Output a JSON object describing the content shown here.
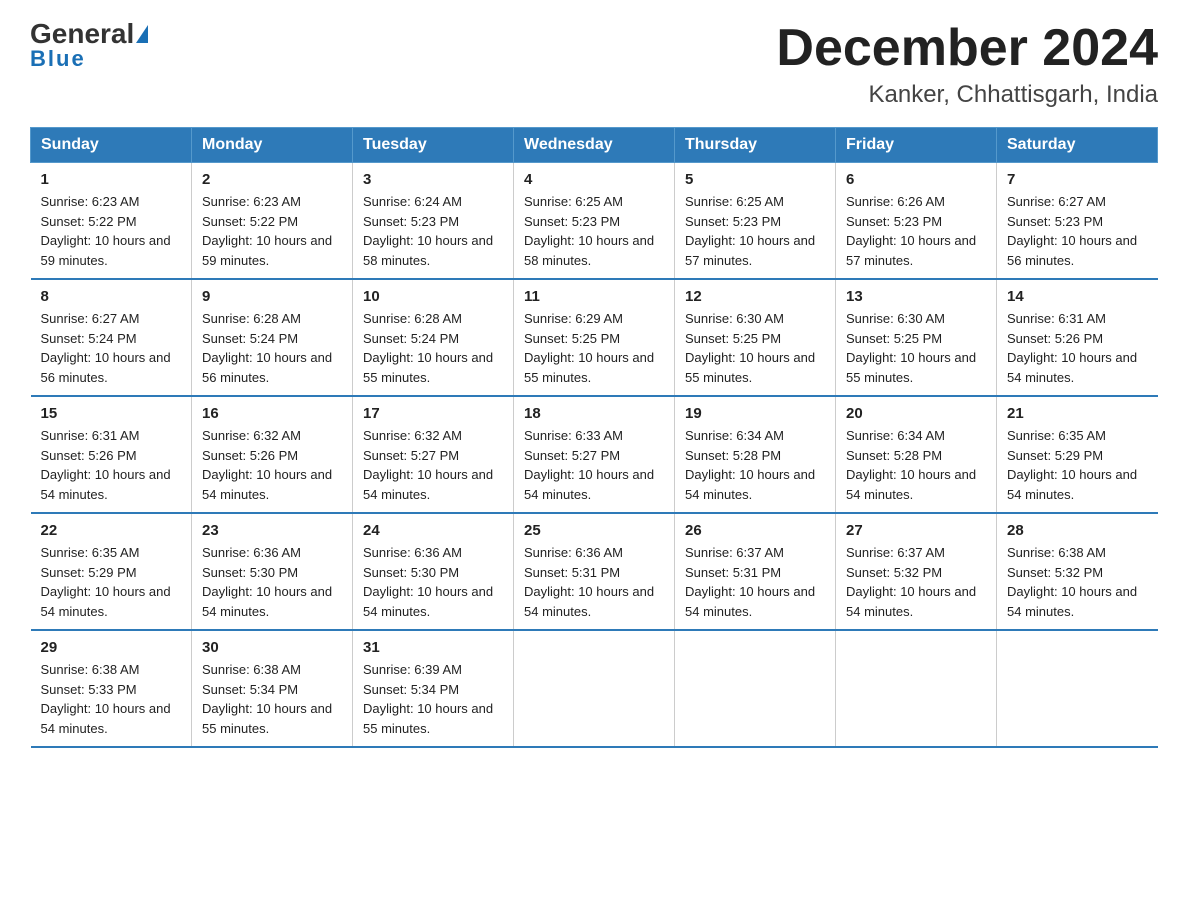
{
  "logo": {
    "text_general": "General",
    "text_blue": "Blue"
  },
  "title": "December 2024",
  "subtitle": "Kanker, Chhattisgarh, India",
  "weekdays": [
    "Sunday",
    "Monday",
    "Tuesday",
    "Wednesday",
    "Thursday",
    "Friday",
    "Saturday"
  ],
  "weeks": [
    [
      {
        "day": "1",
        "sunrise": "6:23 AM",
        "sunset": "5:22 PM",
        "daylight": "10 hours and 59 minutes."
      },
      {
        "day": "2",
        "sunrise": "6:23 AM",
        "sunset": "5:22 PM",
        "daylight": "10 hours and 59 minutes."
      },
      {
        "day": "3",
        "sunrise": "6:24 AM",
        "sunset": "5:23 PM",
        "daylight": "10 hours and 58 minutes."
      },
      {
        "day": "4",
        "sunrise": "6:25 AM",
        "sunset": "5:23 PM",
        "daylight": "10 hours and 58 minutes."
      },
      {
        "day": "5",
        "sunrise": "6:25 AM",
        "sunset": "5:23 PM",
        "daylight": "10 hours and 57 minutes."
      },
      {
        "day": "6",
        "sunrise": "6:26 AM",
        "sunset": "5:23 PM",
        "daylight": "10 hours and 57 minutes."
      },
      {
        "day": "7",
        "sunrise": "6:27 AM",
        "sunset": "5:23 PM",
        "daylight": "10 hours and 56 minutes."
      }
    ],
    [
      {
        "day": "8",
        "sunrise": "6:27 AM",
        "sunset": "5:24 PM",
        "daylight": "10 hours and 56 minutes."
      },
      {
        "day": "9",
        "sunrise": "6:28 AM",
        "sunset": "5:24 PM",
        "daylight": "10 hours and 56 minutes."
      },
      {
        "day": "10",
        "sunrise": "6:28 AM",
        "sunset": "5:24 PM",
        "daylight": "10 hours and 55 minutes."
      },
      {
        "day": "11",
        "sunrise": "6:29 AM",
        "sunset": "5:25 PM",
        "daylight": "10 hours and 55 minutes."
      },
      {
        "day": "12",
        "sunrise": "6:30 AM",
        "sunset": "5:25 PM",
        "daylight": "10 hours and 55 minutes."
      },
      {
        "day": "13",
        "sunrise": "6:30 AM",
        "sunset": "5:25 PM",
        "daylight": "10 hours and 55 minutes."
      },
      {
        "day": "14",
        "sunrise": "6:31 AM",
        "sunset": "5:26 PM",
        "daylight": "10 hours and 54 minutes."
      }
    ],
    [
      {
        "day": "15",
        "sunrise": "6:31 AM",
        "sunset": "5:26 PM",
        "daylight": "10 hours and 54 minutes."
      },
      {
        "day": "16",
        "sunrise": "6:32 AM",
        "sunset": "5:26 PM",
        "daylight": "10 hours and 54 minutes."
      },
      {
        "day": "17",
        "sunrise": "6:32 AM",
        "sunset": "5:27 PM",
        "daylight": "10 hours and 54 minutes."
      },
      {
        "day": "18",
        "sunrise": "6:33 AM",
        "sunset": "5:27 PM",
        "daylight": "10 hours and 54 minutes."
      },
      {
        "day": "19",
        "sunrise": "6:34 AM",
        "sunset": "5:28 PM",
        "daylight": "10 hours and 54 minutes."
      },
      {
        "day": "20",
        "sunrise": "6:34 AM",
        "sunset": "5:28 PM",
        "daylight": "10 hours and 54 minutes."
      },
      {
        "day": "21",
        "sunrise": "6:35 AM",
        "sunset": "5:29 PM",
        "daylight": "10 hours and 54 minutes."
      }
    ],
    [
      {
        "day": "22",
        "sunrise": "6:35 AM",
        "sunset": "5:29 PM",
        "daylight": "10 hours and 54 minutes."
      },
      {
        "day": "23",
        "sunrise": "6:36 AM",
        "sunset": "5:30 PM",
        "daylight": "10 hours and 54 minutes."
      },
      {
        "day": "24",
        "sunrise": "6:36 AM",
        "sunset": "5:30 PM",
        "daylight": "10 hours and 54 minutes."
      },
      {
        "day": "25",
        "sunrise": "6:36 AM",
        "sunset": "5:31 PM",
        "daylight": "10 hours and 54 minutes."
      },
      {
        "day": "26",
        "sunrise": "6:37 AM",
        "sunset": "5:31 PM",
        "daylight": "10 hours and 54 minutes."
      },
      {
        "day": "27",
        "sunrise": "6:37 AM",
        "sunset": "5:32 PM",
        "daylight": "10 hours and 54 minutes."
      },
      {
        "day": "28",
        "sunrise": "6:38 AM",
        "sunset": "5:32 PM",
        "daylight": "10 hours and 54 minutes."
      }
    ],
    [
      {
        "day": "29",
        "sunrise": "6:38 AM",
        "sunset": "5:33 PM",
        "daylight": "10 hours and 54 minutes."
      },
      {
        "day": "30",
        "sunrise": "6:38 AM",
        "sunset": "5:34 PM",
        "daylight": "10 hours and 55 minutes."
      },
      {
        "day": "31",
        "sunrise": "6:39 AM",
        "sunset": "5:34 PM",
        "daylight": "10 hours and 55 minutes."
      },
      null,
      null,
      null,
      null
    ]
  ]
}
